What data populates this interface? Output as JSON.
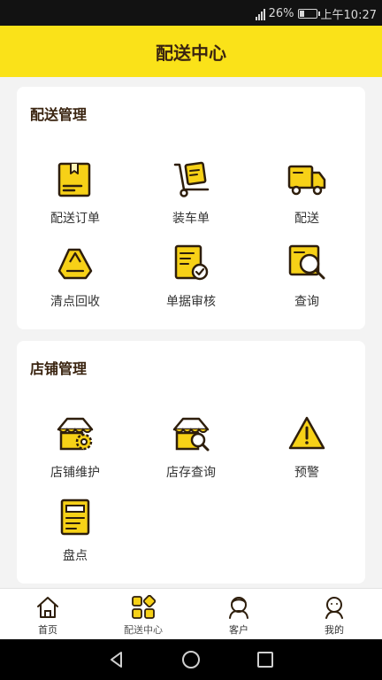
{
  "status_bar": {
    "battery_text": "26%",
    "time": "上午10:27",
    "battery_level": 0.26
  },
  "header": {
    "title": "配送中心"
  },
  "delivery_section": {
    "title": "配送管理",
    "items": [
      {
        "label": "配送订单",
        "icon": "order-box-icon"
      },
      {
        "label": "装车单",
        "icon": "hand-truck-icon"
      },
      {
        "label": "配送",
        "icon": "delivery-truck-icon"
      },
      {
        "label": "清点回收",
        "icon": "recycle-icon"
      },
      {
        "label": "单据审核",
        "icon": "document-check-icon"
      },
      {
        "label": "查询",
        "icon": "search-doc-icon"
      }
    ]
  },
  "store_section": {
    "title": "店铺管理",
    "items": [
      {
        "label": "店铺维护",
        "icon": "store-gear-icon"
      },
      {
        "label": "店存查询",
        "icon": "store-search-icon"
      },
      {
        "label": "预警",
        "icon": "warning-icon"
      },
      {
        "label": "盘点",
        "icon": "inventory-icon"
      }
    ]
  },
  "tab_bar": {
    "tabs": [
      {
        "label": "首页",
        "icon": "home-icon"
      },
      {
        "label": "配送中心",
        "icon": "apps-icon",
        "active": true
      },
      {
        "label": "客户",
        "icon": "customer-icon"
      },
      {
        "label": "我的",
        "icon": "profile-icon"
      }
    ]
  },
  "colors": {
    "accent": "#fae219",
    "icon_fill": "#f7d117",
    "outline": "#2e1e0c",
    "title_text": "#3a2410"
  }
}
